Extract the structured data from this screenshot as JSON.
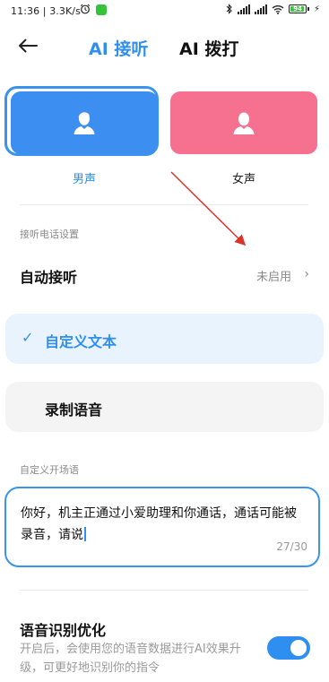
{
  "status_bar": {
    "time": "11:36 | 3.3K/s",
    "battery": "94",
    "battery_level": 0.94,
    "icons": [
      "alarm-icon",
      "app-notification-icon",
      "bluetooth-icon",
      "cell-signal-icon",
      "cell-signal-icon",
      "wifi-icon",
      "battery-icon",
      "charging-icon"
    ]
  },
  "header": {
    "back_icon": "back-arrow-icon",
    "tabs": [
      {
        "label": "AI 接听",
        "active": true
      },
      {
        "label": "AI 拨打",
        "active": false
      }
    ]
  },
  "voices": [
    {
      "label": "男声",
      "selected": true,
      "color": "#3c8ff0",
      "icon": "person-icon"
    },
    {
      "label": "女声",
      "selected": false,
      "color": "#f6718f",
      "icon": "person-icon"
    }
  ],
  "call_settings": {
    "section_title": "接听电话设置",
    "auto_answer": {
      "label": "自动接听",
      "status": "未启用",
      "chevron": "›"
    }
  },
  "options": [
    {
      "label": "自定义文本",
      "selected": true,
      "check": "✓"
    },
    {
      "label": "录制语音",
      "selected": false
    }
  ],
  "opener": {
    "section_title": "自定义开场语",
    "text": "你好，机主正通过小爱助理和你通话，通话可能被录音，请说",
    "counter": "27/30"
  },
  "speech_optimization": {
    "title": "语音识别优化",
    "description": "开启后，会使用您的语音数据进行AI效果升级，可更好地识别你的指令",
    "enabled": true
  },
  "colors": {
    "accent": "#2f8ff0",
    "male": "#3c8ff0",
    "female": "#f6718f",
    "selected_option_bg": "#e9f3fe",
    "annotation_arrow": "#d9342b"
  }
}
